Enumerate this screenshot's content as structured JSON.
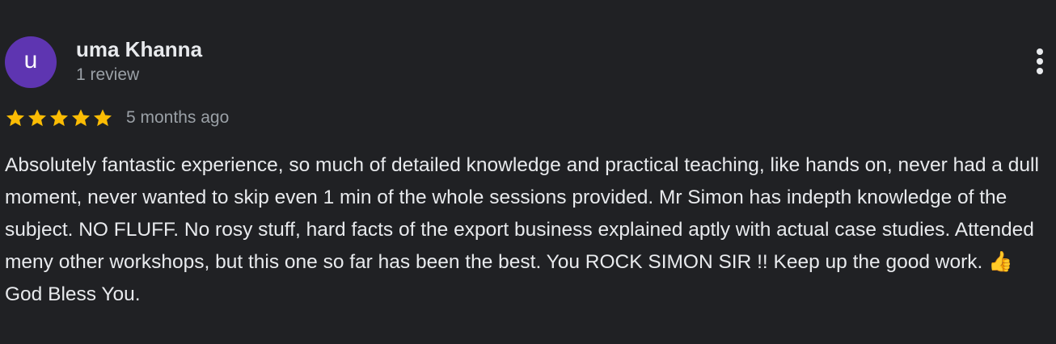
{
  "reviewer": {
    "initial": "u",
    "name": "uma Khanna",
    "review_count": "1 review",
    "avatar_color": "#5e35b1"
  },
  "menu": {
    "icon": "more-vert-icon"
  },
  "rating": {
    "stars": 5,
    "max_stars": 5,
    "star_color": "#fbbc04",
    "date": "5 months ago"
  },
  "review": {
    "text": "Absolutely fantastic experience, so much of detailed knowledge and practical teaching, like hands on, never had a dull moment, never wanted to skip even 1 min of the whole sessions provided. Mr Simon has indepth knowledge of the subject. NO FLUFF. No rosy stuff, hard facts of the export business explained aptly with actual case studies. Attended meny other workshops, but this one so far has been the best. You ROCK SIMON SIR !! Keep up the good work. 👍 God Bless You."
  }
}
